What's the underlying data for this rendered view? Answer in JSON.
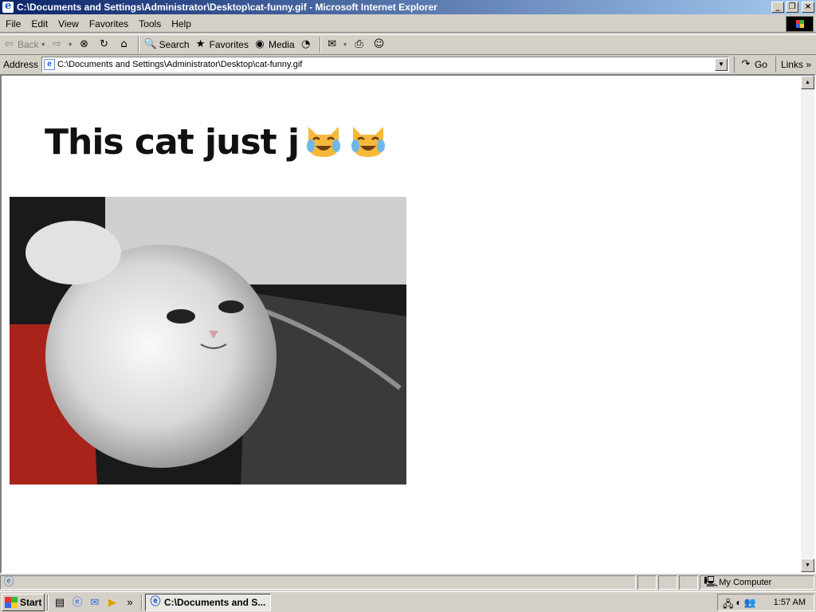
{
  "window": {
    "title": "C:\\Documents and Settings\\Administrator\\Desktop\\cat-funny.gif - Microsoft Internet Explorer"
  },
  "menu": [
    "File",
    "Edit",
    "View",
    "Favorites",
    "Tools",
    "Help"
  ],
  "toolbar": {
    "back": "Back",
    "search": "Search",
    "favorites": "Favorites",
    "media": "Media"
  },
  "address": {
    "label": "Address",
    "value": "C:\\Documents and Settings\\Administrator\\Desktop\\cat-funny.gif",
    "go": "Go",
    "links": "Links"
  },
  "page": {
    "headline": "This cat just j"
  },
  "status": {
    "zone": "My Computer"
  },
  "taskbar": {
    "start": "Start",
    "task": "C:\\Documents and S...",
    "clock": "1:57 AM"
  },
  "colors": {
    "titlebar_start": "#0a246a",
    "titlebar_end": "#a6caf0",
    "chrome": "#d4d0c8"
  }
}
